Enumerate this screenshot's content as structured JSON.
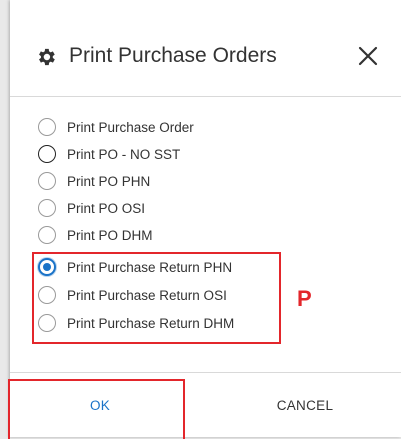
{
  "dialog": {
    "title": "Print Purchase Orders",
    "options": [
      {
        "label": "Print Purchase Order",
        "checked": false
      },
      {
        "label": "Print PO - NO SST",
        "checked": false
      },
      {
        "label": "Print PO PHN",
        "checked": false
      },
      {
        "label": "Print PO OSI",
        "checked": false
      },
      {
        "label": "Print PO DHM",
        "checked": false
      },
      {
        "label": "Print Purchase Return PHN",
        "checked": true
      },
      {
        "label": "Print Purchase Return OSI",
        "checked": false
      },
      {
        "label": "Print Purchase Return DHM",
        "checked": false
      }
    ],
    "ok_label": "OK",
    "cancel_label": "CANCEL"
  },
  "annotation": {
    "letter": "P",
    "color": "#e3262b"
  },
  "colors": {
    "accent": "#1a73c8",
    "annotation": "#e3262b"
  },
  "icons": {
    "header": "gear-icon",
    "close": "close-icon"
  }
}
